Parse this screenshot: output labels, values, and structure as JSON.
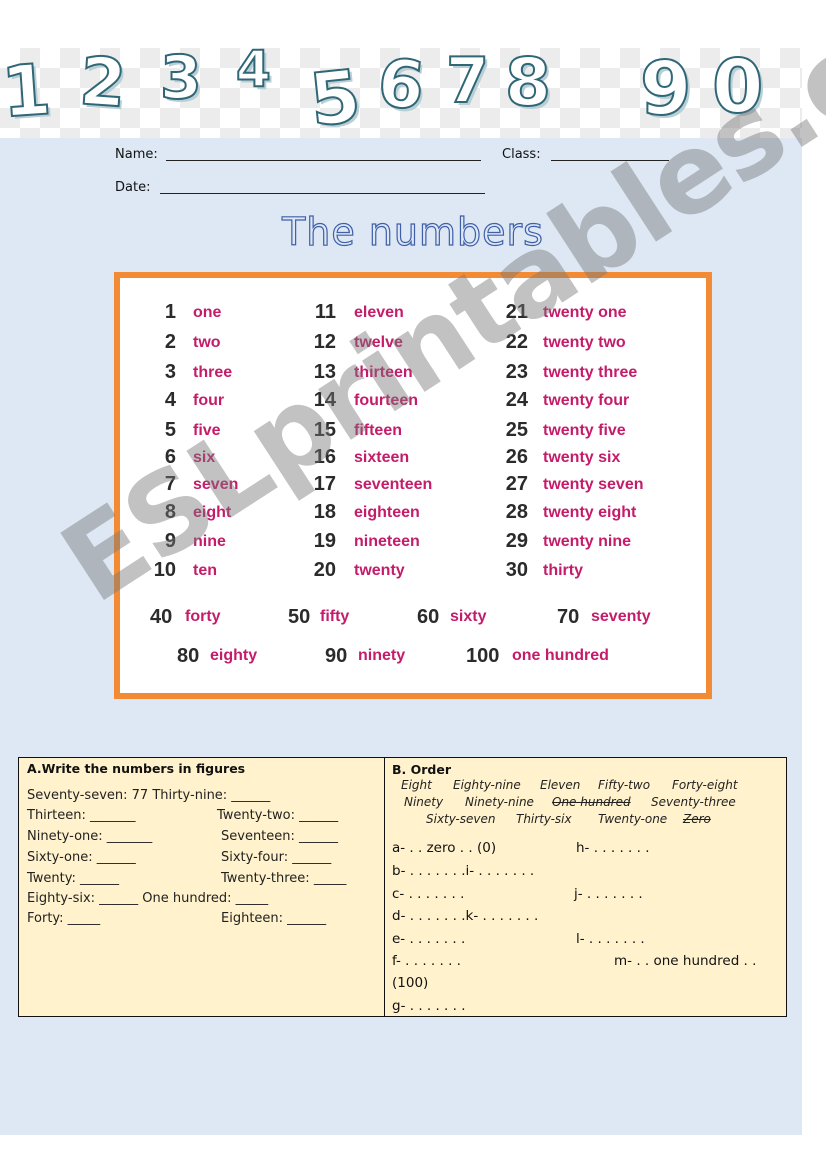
{
  "banner": {
    "digits": [
      "1",
      "2",
      "3",
      "4",
      "5",
      "6",
      "7",
      "8",
      "9",
      "0"
    ]
  },
  "header": {
    "name_label": "Name:",
    "class_label": "Class:",
    "date_label": "Date:"
  },
  "title": "The numbers",
  "numbers": {
    "col1": [
      {
        "n": "1",
        "w": "one"
      },
      {
        "n": "2",
        "w": "two"
      },
      {
        "n": "3",
        "w": "three"
      },
      {
        "n": "4",
        "w": "four"
      },
      {
        "n": "5",
        "w": "five"
      },
      {
        "n": "6",
        "w": "six"
      },
      {
        "n": "7",
        "w": "seven"
      },
      {
        "n": "8",
        "w": "eight"
      },
      {
        "n": "9",
        "w": "nine"
      },
      {
        "n": "10",
        "w": "ten"
      }
    ],
    "col2": [
      {
        "n": "11",
        "w": "eleven"
      },
      {
        "n": "12",
        "w": "twelve"
      },
      {
        "n": "13",
        "w": "thirteen"
      },
      {
        "n": "14",
        "w": "fourteen"
      },
      {
        "n": "15",
        "w": "fifteen"
      },
      {
        "n": "16",
        "w": "sixteen"
      },
      {
        "n": "17",
        "w": "seventeen"
      },
      {
        "n": "18",
        "w": "eighteen"
      },
      {
        "n": "19",
        "w": "nineteen"
      },
      {
        "n": "20",
        "w": "twenty"
      }
    ],
    "col3": [
      {
        "n": "21",
        "w": "twenty one"
      },
      {
        "n": "22",
        "w": "twenty two"
      },
      {
        "n": "23",
        "w": "twenty three"
      },
      {
        "n": "24",
        "w": "twenty four"
      },
      {
        "n": "25",
        "w": "twenty five"
      },
      {
        "n": "26",
        "w": "twenty six"
      },
      {
        "n": "27",
        "w": "twenty seven"
      },
      {
        "n": "28",
        "w": "twenty eight"
      },
      {
        "n": "29",
        "w": "twenty nine"
      },
      {
        "n": "30",
        "w": "thirty"
      }
    ],
    "tens_row1": [
      {
        "n": "40",
        "w": "forty"
      },
      {
        "n": "50",
        "w": "fifty"
      },
      {
        "n": "60",
        "w": "sixty"
      },
      {
        "n": "70",
        "w": "seventy"
      }
    ],
    "tens_row2": [
      {
        "n": "80",
        "w": "eighty"
      },
      {
        "n": "90",
        "w": "ninety"
      },
      {
        "n": "100",
        "w": "one hundred"
      }
    ]
  },
  "watermark": "ESLprintables.com",
  "exercise_a": {
    "heading": "A.Write the numbers in figures",
    "lines": [
      "Seventy-seven:  77  Thirty-nine: ______",
      "Thirteen: _______",
      "Twenty-two: ______",
      "Ninety-one: _______",
      "Seventeen: ______",
      "Sixty-one: ______",
      "Sixty-four: ______",
      "Twenty: ______",
      "Twenty-three: _____",
      "Eighty-six: ______  One hundred: _____",
      "Forty: _____",
      "Eighteen: ______"
    ]
  },
  "exercise_b": {
    "heading": "B. Order",
    "words_row1": [
      "Eight",
      "Eighty-nine",
      "Eleven",
      "Fifty-two",
      "Forty-eight"
    ],
    "words_row2": [
      "Ninety",
      "Ninety-nine",
      "One hundred",
      "Seventy-three"
    ],
    "words_row3": [
      "Sixty-seven",
      "Thirty-six",
      "Twenty-one",
      "Zero"
    ],
    "crossed_out": [
      "One hundred",
      "Zero"
    ],
    "answers": {
      "a": "a- . . zero . . (0)",
      "h": "h-  . . . . . . .",
      "b": "b-  . . . . . . .i-  . . . . . . .",
      "c": "c-  . . . . . . .",
      "j": "j-  . . . . . . .",
      "d": "d-  . . . . . . .k-  . . . . . . .",
      "e": "e-  . . . . . . .",
      "l": "l-  . . . . . . .",
      "f": "f-  . . . . . . .",
      "m": "m-  . . one hundred  . .",
      "m_cont": "(100)",
      "g": "g-  . . . . . . ."
    }
  }
}
